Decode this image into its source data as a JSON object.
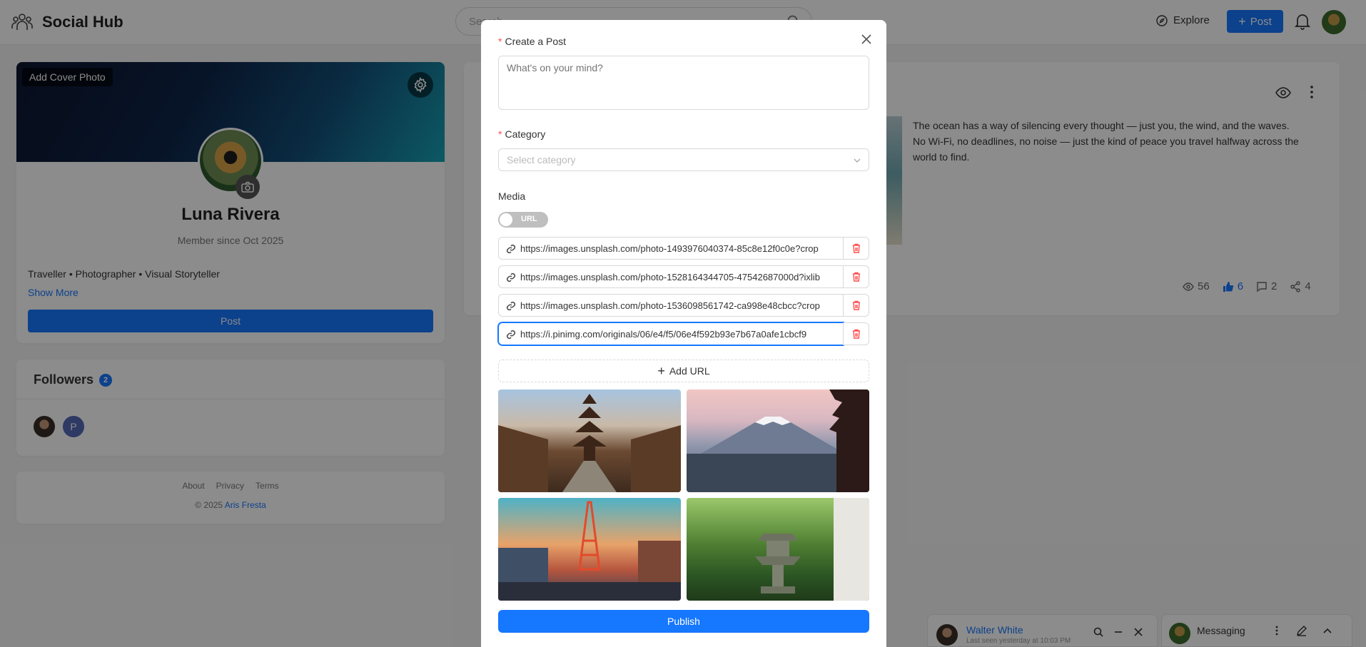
{
  "header": {
    "app_name": "Social Hub",
    "search_placeholder": "Search...",
    "explore_label": "Explore",
    "post_label": "Post"
  },
  "profile": {
    "add_cover_label": "Add Cover Photo",
    "name": "Luna Rivera",
    "member_since": "Member since Oct 2025",
    "bio": "Traveller • Photographer • Visual Storyteller",
    "show_more": "Show More",
    "post_button": "Post"
  },
  "followers": {
    "title": "Followers",
    "count": "2",
    "items": [
      {
        "initial": "",
        "icon": "avatar-photo"
      },
      {
        "initial": "P",
        "icon": "avatar-initial"
      }
    ]
  },
  "footer": {
    "links": [
      "About",
      "Privacy",
      "Terms"
    ],
    "copyright": "© 2025",
    "author": "Aris Fresta"
  },
  "feed_post": {
    "text_line1": "The ocean has a way of silencing every thought — just you, the wind, and the waves.",
    "text_line2": "No Wi-Fi, no deadlines, no noise — just the kind of peace you travel halfway across the",
    "text_line3": "world to find.",
    "views": "56",
    "likes": "6",
    "comments": "2",
    "shares": "4"
  },
  "modal": {
    "title": "Create a Post",
    "textarea_placeholder": "What's on your mind?",
    "category_label": "Category",
    "category_placeholder": "Select category",
    "media_label": "Media",
    "toggle_label": "URL",
    "urls": [
      "https://images.unsplash.com/photo-1493976040374-85c8e12f0c0e?crop",
      "https://images.unsplash.com/photo-1528164344705-47542687000d?ixlib",
      "https://images.unsplash.com/photo-1536098561742-ca998e48cbcc?crop",
      "https://i.pinimg.com/originals/06/e4/f5/06e4f592b93e7b67a0afe1cbcf9"
    ],
    "add_url_label": "Add URL",
    "publish_label": "Publish"
  },
  "chat": {
    "contact_name": "Walter White",
    "last_seen": "Last seen yesterday at 10:03 PM",
    "messaging_label": "Messaging"
  },
  "colors": {
    "primary": "#1677ff",
    "required": "#ff4d4f",
    "danger": "#ff4d4f"
  }
}
